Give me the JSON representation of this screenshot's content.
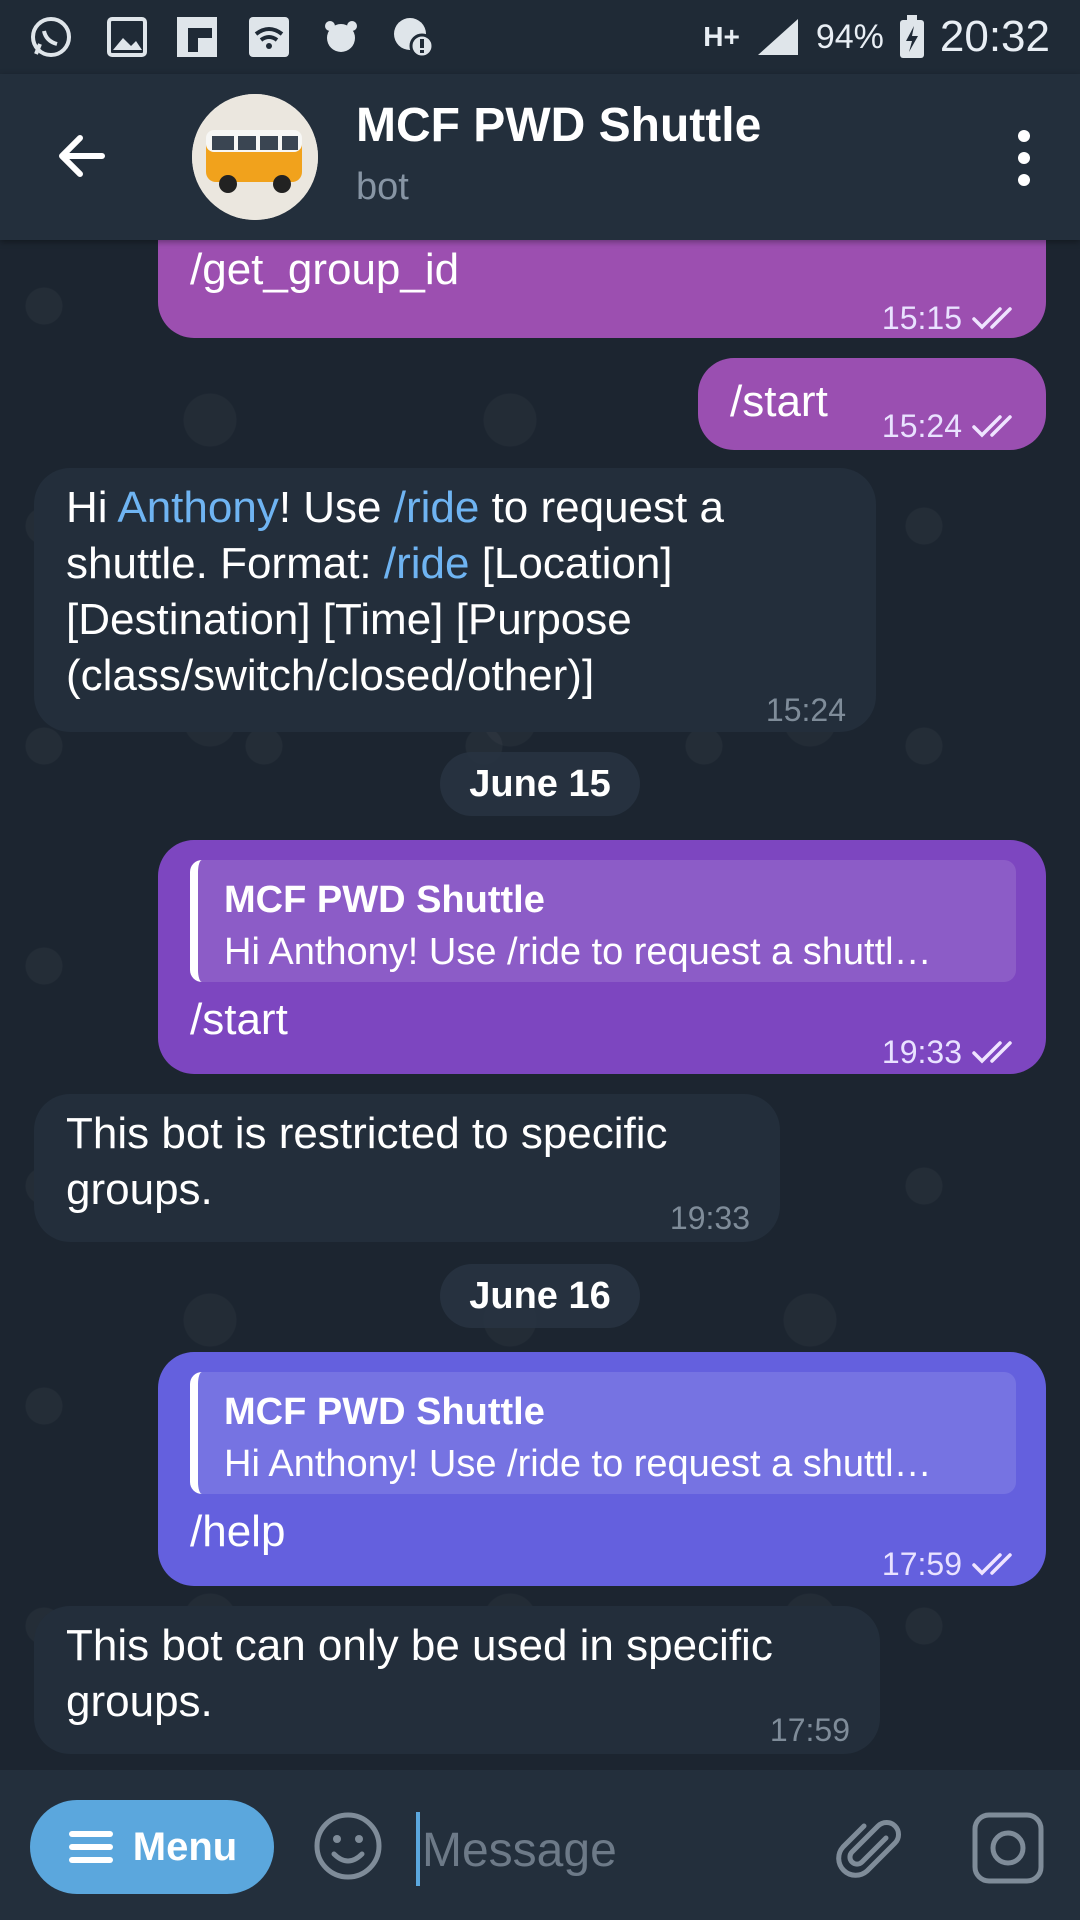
{
  "status_bar": {
    "network": "H+",
    "battery": "94%",
    "time": "20:32"
  },
  "header": {
    "title": "MCF PWD Shuttle",
    "subtitle": "bot"
  },
  "messages": {
    "m1": {
      "text": "/get_group_id",
      "time": "15:15"
    },
    "m2": {
      "text": "/start",
      "time": "15:24"
    },
    "m3": {
      "p1": "Hi ",
      "name": "Anthony",
      "p2": "! Use ",
      "cmd1": "/ride",
      "p3": " to request a shuttle. Format: ",
      "cmd2": "/ride",
      "p4": " [Location] [Destination] [Time] [Purpose (class/switch/closed/other)]",
      "time": "15:24"
    },
    "date1": "June 15",
    "m4": {
      "reply_name": "MCF PWD Shuttle",
      "reply_text": "Hi Anthony! Use /ride to request a shuttl…",
      "text": "/start",
      "time": "19:33"
    },
    "m5": {
      "text": "This bot is restricted to specific groups.",
      "time": "19:33"
    },
    "date2": "June 16",
    "m6": {
      "reply_name": "MCF PWD Shuttle",
      "reply_text": "Hi Anthony! Use /ride to request a shuttl…",
      "text": "/help",
      "time": "17:59"
    },
    "m7": {
      "text": "This bot can only be used in specific groups.",
      "time": "17:59"
    }
  },
  "input_bar": {
    "menu_label": "Menu",
    "placeholder": "Message"
  },
  "colors": {
    "outgoing_top": "#9c4fb0",
    "outgoing_mid": "#7d46c0",
    "outgoing_bottom": "#5f63e0",
    "incoming": "#232e3b",
    "link": "#6fb4f2",
    "menu_button": "#5ba7dd"
  }
}
